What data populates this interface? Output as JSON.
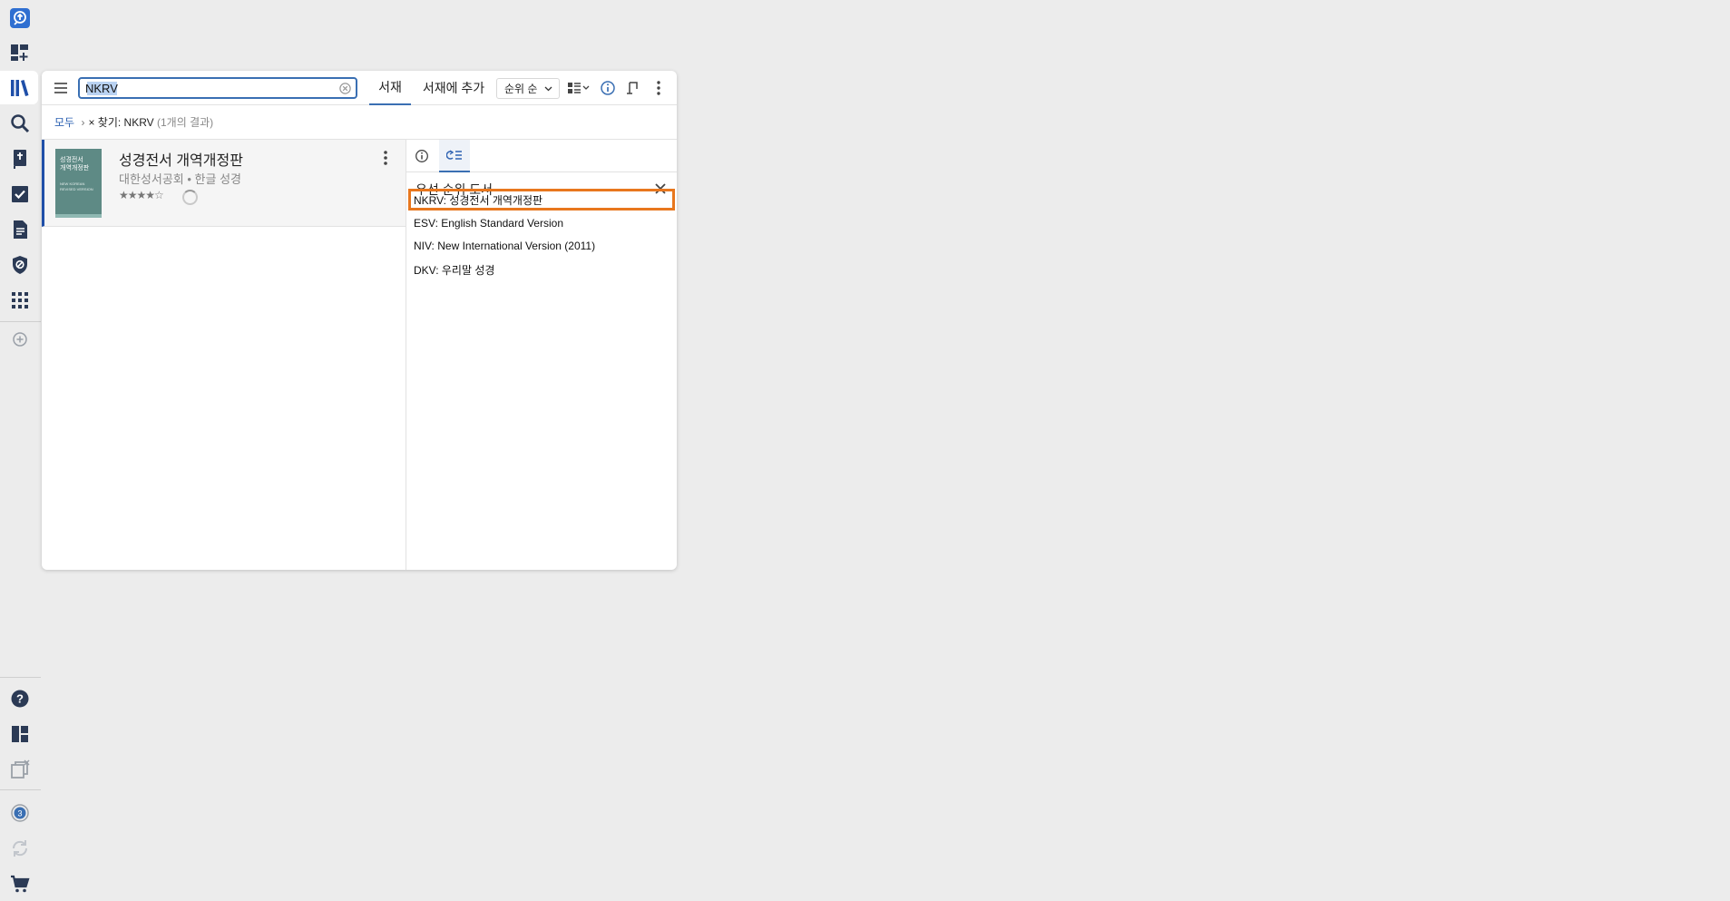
{
  "rail": {
    "items": [
      "home-icon",
      "dashboard-add-icon",
      "library-icon",
      "search-icon",
      "bible-icon",
      "tasks-icon",
      "document-icon",
      "shield-icon",
      "apps-icon",
      "add-circle-icon"
    ],
    "bottom": [
      "help-icon",
      "layout-icon",
      "close-panels-icon"
    ],
    "badge": "3"
  },
  "toolbar": {
    "search_value": "NKRV",
    "tab_library": "서재",
    "tab_add": "서재에 추가",
    "sort_label": "순위 순"
  },
  "breadcrumb": {
    "all": "모두",
    "separator": "›",
    "remove": "×",
    "query": "찾기: NKRV",
    "count": "(1개의 결과)"
  },
  "book": {
    "title": "성경전서 개역개정판",
    "subtitle": "대한성서공회 • 한글 성경",
    "stars": "★★★★☆",
    "cover_title_line1": "성경전서",
    "cover_title_line2": "개역개정판",
    "cover_sub_line1": "NEW KOREAN",
    "cover_sub_line2": "REVISED VERSION"
  },
  "priority": {
    "title": "우선 순위 도서",
    "items": [
      "NKRV: 성경전서 개역개정판",
      "ESV: English Standard Version",
      "NIV: New International Version (2011)",
      "DKV: 우리말 성경"
    ]
  },
  "colors": {
    "accent": "#3a6fb3",
    "highlight": "#e8771e",
    "rail_icon": "#2b3a55"
  }
}
